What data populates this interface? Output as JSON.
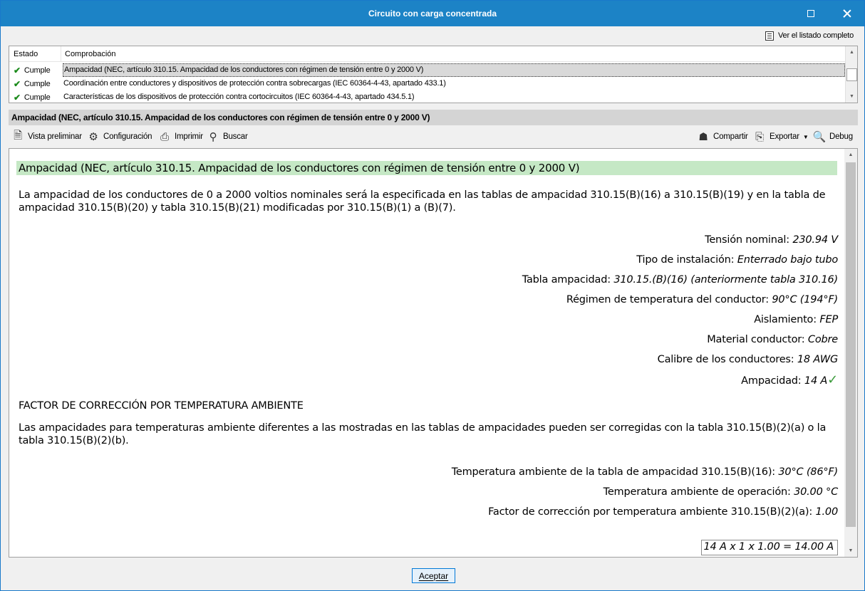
{
  "window": {
    "title": "Circuito con carga concentrada"
  },
  "listing": {
    "label": "Ver el listado completo"
  },
  "checks": {
    "columns": {
      "status": "Estado",
      "check": "Comprobación"
    },
    "rows": [
      {
        "status": "Cumple",
        "description": "Ampacidad (NEC, artículo 310.15. Ampacidad de los conductores con régimen de tensión entre 0 y 2000 V)"
      },
      {
        "status": "Cumple",
        "description": "Coordinación entre conductores y dispositivos de protección contra sobrecargas (IEC 60364-4-43, apartado 433.1)"
      },
      {
        "status": "Cumple",
        "description": "Características de los dispositivos de protección contra cortocircuitos (IEC 60364-4-43, apartado 434.5.1)"
      }
    ]
  },
  "section": {
    "title": "Ampacidad (NEC, artículo 310.15. Ampacidad de los conductores con régimen de tensión entre 0 y 2000 V)"
  },
  "toolbar": {
    "preview": "Vista preliminar",
    "settings": "Configuración",
    "print": "Imprimir",
    "search": "Buscar",
    "share": "Compartir",
    "export": "Exportar",
    "debug": "Debug"
  },
  "report": {
    "heading": "Ampacidad (NEC, artículo 310.15. Ampacidad de los conductores con régimen de tensión entre 0 y 2000 V)",
    "intro": "La ampacidad de los conductores de 0 a 2000 voltios nominales será la especificada en las tablas de ampacidad 310.15(B)(16) a 310.15(B)(19) y en la tabla de ampacidad 310.15(B)(20) y tabla 310.15(B)(21) modificadas por 310.15(B)(1) a (B)(7).",
    "params": [
      {
        "label": "Tensión nominal:",
        "value": "230.94 V"
      },
      {
        "label": "Tipo de instalación:",
        "value": "Enterrado bajo tubo"
      },
      {
        "label": "Tabla ampacidad:",
        "value": "310.15.(B)(16) (anteriormente tabla 310.16)"
      },
      {
        "label": "Régimen de temperatura del conductor:",
        "value": "90°C (194°F)"
      },
      {
        "label": "Aislamiento:",
        "value": "FEP"
      },
      {
        "label": "Material conductor:",
        "value": "Cobre"
      },
      {
        "label": "Calibre de los conductores:",
        "value": "18 AWG"
      },
      {
        "label": "Ampacidad:",
        "value": "14 A"
      }
    ],
    "temp_heading": "FACTOR DE CORRECCIÓN POR TEMPERATURA AMBIENTE",
    "temp_text": "Las ampacidades para temperaturas ambiente diferentes a las mostradas en las tablas de ampacidades pueden ser corregidas con la tabla 310.15(B)(2)(a) o la tabla 310.15(B)(2)(b).",
    "temp_params": [
      {
        "label": "Temperatura ambiente de la tabla de ampacidad 310.15(B)(16):",
        "value": "30°C (86°F)"
      },
      {
        "label": "Temperatura ambiente de operación:",
        "value": "30.00 °C"
      },
      {
        "label": "Factor de corrección por temperatura ambiente 310.15(B)(2)(a):",
        "value": "1.00"
      }
    ],
    "formula": "14 A x 1 x 1.00 = 14.00 A"
  },
  "footer": {
    "ok": "Aceptar"
  }
}
